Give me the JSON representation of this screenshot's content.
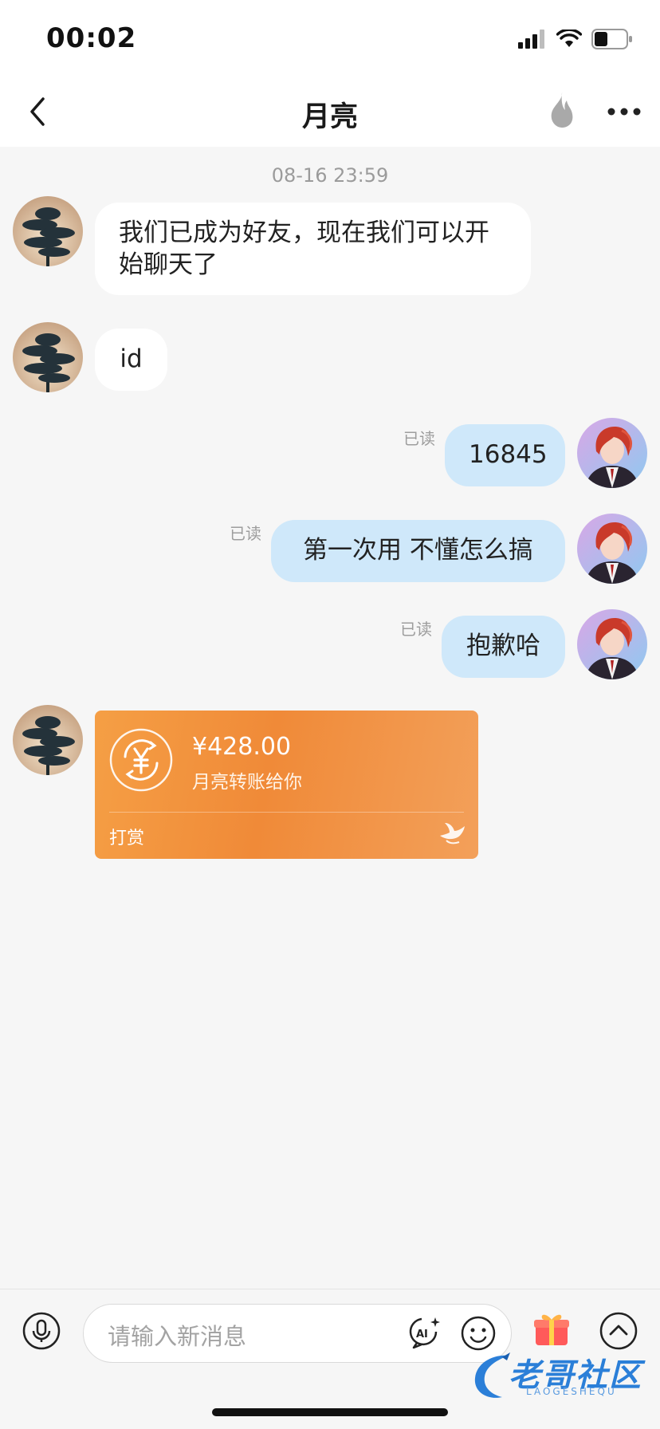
{
  "status_bar": {
    "time": "00:02",
    "icons": [
      "signal-icon",
      "wifi-icon",
      "battery-icon"
    ]
  },
  "nav": {
    "title": "月亮",
    "back_icon": "chevron-left-icon",
    "burn_icon": "flame-icon",
    "more_icon": "more-dots-icon"
  },
  "chat": {
    "timestamp": "08-16 23:59",
    "messages": [
      {
        "side": "in",
        "text": "我们已成为好友，现在我们可以开始聊天了"
      },
      {
        "side": "in",
        "text": "id"
      },
      {
        "side": "out",
        "text": "16845",
        "status": "已读"
      },
      {
        "side": "out",
        "text": "第一次用  不懂怎么搞",
        "status": "已读"
      },
      {
        "side": "out",
        "text": "抱歉哈",
        "status": "已读"
      }
    ],
    "transfer": {
      "amount": "¥428.00",
      "description": "月亮转账给你",
      "footer": "打赏",
      "icon": "yuan-coin-icon"
    }
  },
  "input_bar": {
    "placeholder": "请输入新消息",
    "icons": [
      "mic-icon",
      "ai-icon",
      "emoji-icon",
      "gift-icon",
      "chevron-up-icon"
    ]
  },
  "watermark": {
    "text": "老哥社区",
    "sub": "LAOGESHEQU"
  },
  "colors": {
    "outgoing_bubble": "#cfe8fa",
    "incoming_bubble": "#ffffff",
    "transfer_card": "#f3973f",
    "background": "#f6f6f6"
  }
}
